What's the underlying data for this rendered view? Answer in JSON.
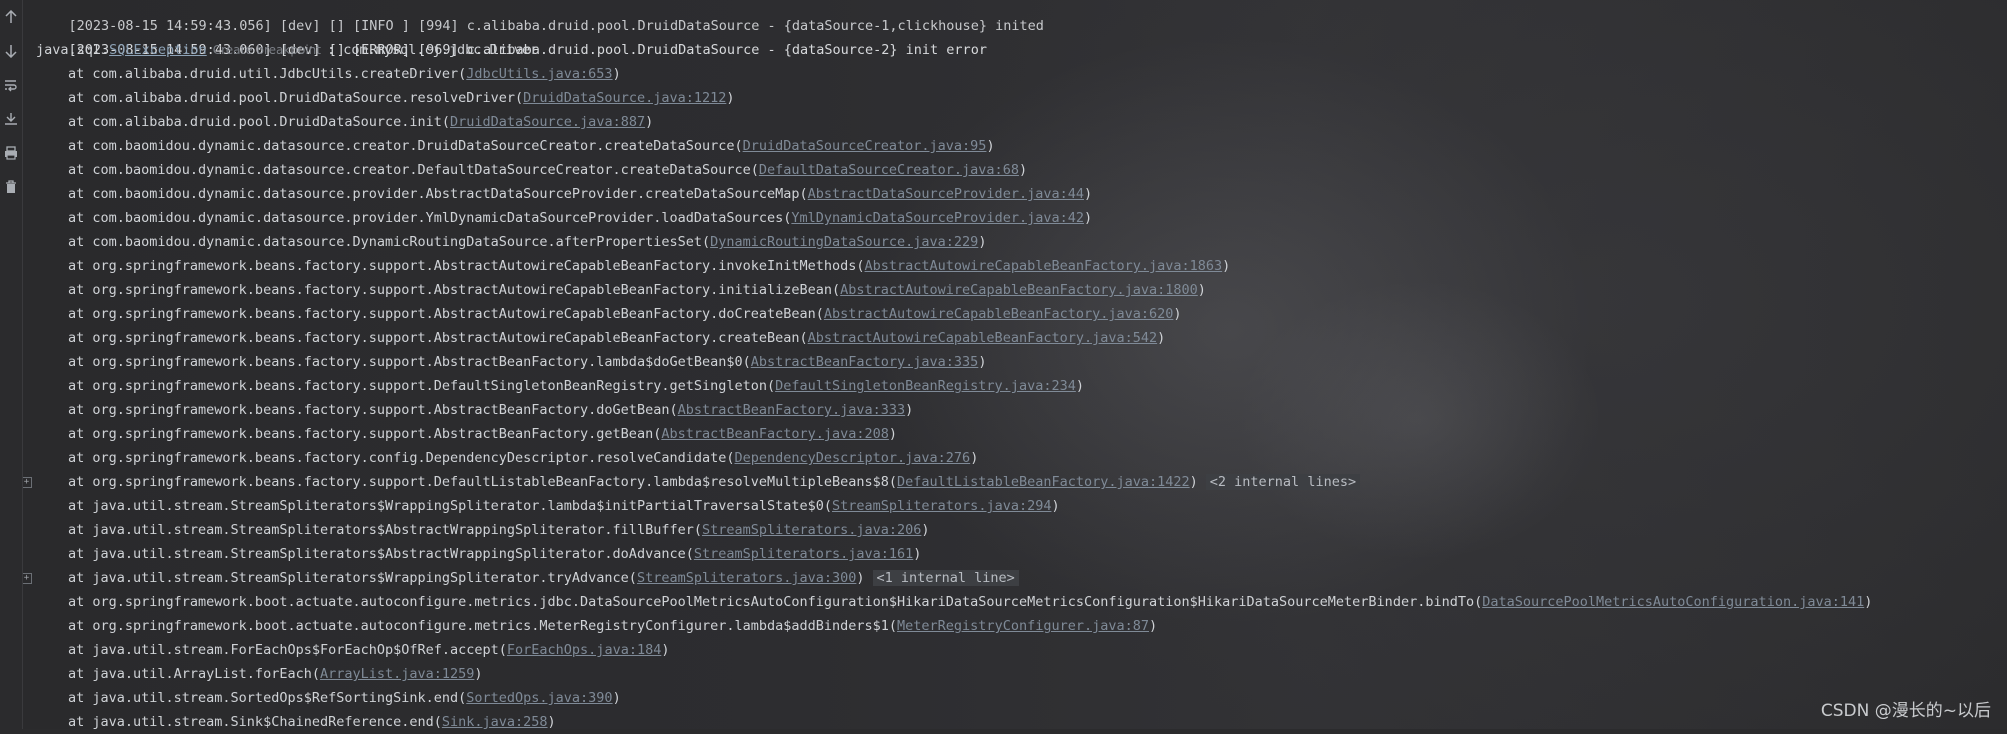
{
  "toolbar": {
    "icons": [
      "arrow-up-icon",
      "arrow-down-icon",
      "soft-wrap-icon",
      "scroll-to-end-icon",
      "print-icon",
      "clear-icon"
    ]
  },
  "console": {
    "header_lines": [
      {
        "prefix": "[2023-08-15 14:59:43.056] [dev] [] [INFO ] [994] c.alibaba.druid.pool.DruidDataSource - {dataSource-1,clickhouse} inited"
      },
      {
        "prefix": "[2023-08-15 14:59:43.060] [dev] [] [ERROR] [969] c.alibaba.druid.pool.DruidDataSource - {dataSource-2} init error"
      }
    ],
    "exception": {
      "pkg": "java.sql.",
      "name": "SQLException",
      "breakpoint_label": "Create breakpoint",
      "message": ": com.mysql.cj.jdbc.Driver"
    },
    "frames": [
      {
        "text": "at com.alibaba.druid.util.JdbcUtils.createDriver(",
        "link": "JdbcUtils.java:653",
        "suffix": ")"
      },
      {
        "text": "at com.alibaba.druid.pool.DruidDataSource.resolveDriver(",
        "link": "DruidDataSource.java:1212",
        "suffix": ")"
      },
      {
        "text": "at com.alibaba.druid.pool.DruidDataSource.init(",
        "link": "DruidDataSource.java:887",
        "suffix": ")"
      },
      {
        "text": "at com.baomidou.dynamic.datasource.creator.DruidDataSourceCreator.createDataSource(",
        "link": "DruidDataSourceCreator.java:95",
        "suffix": ")"
      },
      {
        "text": "at com.baomidou.dynamic.datasource.creator.DefaultDataSourceCreator.createDataSource(",
        "link": "DefaultDataSourceCreator.java:68",
        "suffix": ")"
      },
      {
        "text": "at com.baomidou.dynamic.datasource.provider.AbstractDataSourceProvider.createDataSourceMap(",
        "link": "AbstractDataSourceProvider.java:44",
        "suffix": ")"
      },
      {
        "text": "at com.baomidou.dynamic.datasource.provider.YmlDynamicDataSourceProvider.loadDataSources(",
        "link": "YmlDynamicDataSourceProvider.java:42",
        "suffix": ")"
      },
      {
        "text": "at com.baomidou.dynamic.datasource.DynamicRoutingDataSource.afterPropertiesSet(",
        "link": "DynamicRoutingDataSource.java:229",
        "suffix": ")"
      },
      {
        "text": "at org.springframework.beans.factory.support.AbstractAutowireCapableBeanFactory.invokeInitMethods(",
        "link": "AbstractAutowireCapableBeanFactory.java:1863",
        "suffix": ")"
      },
      {
        "text": "at org.springframework.beans.factory.support.AbstractAutowireCapableBeanFactory.initializeBean(",
        "link": "AbstractAutowireCapableBeanFactory.java:1800",
        "suffix": ")"
      },
      {
        "text": "at org.springframework.beans.factory.support.AbstractAutowireCapableBeanFactory.doCreateBean(",
        "link": "AbstractAutowireCapableBeanFactory.java:620",
        "suffix": ")"
      },
      {
        "text": "at org.springframework.beans.factory.support.AbstractAutowireCapableBeanFactory.createBean(",
        "link": "AbstractAutowireCapableBeanFactory.java:542",
        "suffix": ")"
      },
      {
        "text": "at org.springframework.beans.factory.support.AbstractBeanFactory.lambda$doGetBean$0(",
        "link": "AbstractBeanFactory.java:335",
        "suffix": ")"
      },
      {
        "text": "at org.springframework.beans.factory.support.DefaultSingletonBeanRegistry.getSingleton(",
        "link": "DefaultSingletonBeanRegistry.java:234",
        "suffix": ")"
      },
      {
        "text": "at org.springframework.beans.factory.support.AbstractBeanFactory.doGetBean(",
        "link": "AbstractBeanFactory.java:333",
        "suffix": ")"
      },
      {
        "text": "at org.springframework.beans.factory.support.AbstractBeanFactory.getBean(",
        "link": "AbstractBeanFactory.java:208",
        "suffix": ")"
      },
      {
        "text": "at org.springframework.beans.factory.config.DependencyDescriptor.resolveCandidate(",
        "link": "DependencyDescriptor.java:276",
        "suffix": ")"
      },
      {
        "text": "at org.springframework.beans.factory.support.DefaultListableBeanFactory.lambda$resolveMultipleBeans$8(",
        "link": "DefaultListableBeanFactory.java:1422",
        "suffix": ")",
        "fold": "<2 internal lines>"
      },
      {
        "text": "at java.util.stream.StreamSpliterators$WrappingSpliterator.lambda$initPartialTraversalState$0(",
        "link": "StreamSpliterators.java:294",
        "suffix": ")"
      },
      {
        "text": "at java.util.stream.StreamSpliterators$AbstractWrappingSpliterator.fillBuffer(",
        "link": "StreamSpliterators.java:206",
        "suffix": ")"
      },
      {
        "text": "at java.util.stream.StreamSpliterators$AbstractWrappingSpliterator.doAdvance(",
        "link": "StreamSpliterators.java:161",
        "suffix": ")"
      },
      {
        "text": "at java.util.stream.StreamSpliterators$WrappingSpliterator.tryAdvance(",
        "link": "StreamSpliterators.java:300",
        "suffix": ")",
        "fold": "<1 internal line>"
      },
      {
        "text": "at org.springframework.boot.actuate.autoconfigure.metrics.jdbc.DataSourcePoolMetricsAutoConfiguration$HikariDataSourceMetricsConfiguration$HikariDataSourceMeterBinder.bindTo(",
        "link": "DataSourcePoolMetricsAutoConfiguration.java:141",
        "suffix": ")"
      },
      {
        "text": "at org.springframework.boot.actuate.autoconfigure.metrics.MeterRegistryConfigurer.lambda$addBinders$1(",
        "link": "MeterRegistryConfigurer.java:87",
        "suffix": ")"
      },
      {
        "text": "at java.util.stream.ForEachOps$ForEachOp$OfRef.accept(",
        "link": "ForEachOps.java:184",
        "suffix": ")"
      },
      {
        "text": "at java.util.ArrayList.forEach(",
        "link": "ArrayList.java:1259",
        "suffix": ")"
      },
      {
        "text": "at java.util.stream.SortedOps$RefSortingSink.end(",
        "link": "SortedOps.java:390",
        "suffix": ")"
      },
      {
        "text": "at java.util.stream.Sink$ChainedReference.end(",
        "link": "Sink.java:258",
        "suffix": ")"
      }
    ]
  },
  "watermark": "CSDN @漫长的~以后"
}
